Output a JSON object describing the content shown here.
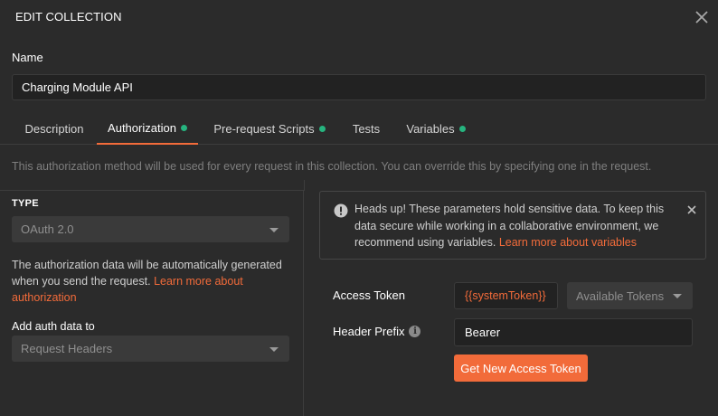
{
  "modal": {
    "title": "EDIT COLLECTION"
  },
  "name_field": {
    "label": "Name",
    "value": "Charging Module API"
  },
  "tabs": [
    {
      "label": "Description",
      "active": false,
      "has_dot": false
    },
    {
      "label": "Authorization",
      "active": true,
      "has_dot": true
    },
    {
      "label": "Pre-request Scripts",
      "active": false,
      "has_dot": true
    },
    {
      "label": "Tests",
      "active": false,
      "has_dot": false
    },
    {
      "label": "Variables",
      "active": false,
      "has_dot": true
    }
  ],
  "info_text": "This authorization method will be used for every request in this collection. You can override this by specifying one in the request.",
  "left": {
    "type_label": "TYPE",
    "type_value": "OAuth 2.0",
    "desc_text": "The authorization data will be automatically generated when you send the request.",
    "desc_link": "Learn more about authorization",
    "add_auth_label": "Add auth data to",
    "add_auth_value": "Request Headers"
  },
  "alert": {
    "text": "Heads up! These parameters hold sensitive data. To keep this data secure while working in a collaborative environment, we recommend using variables.",
    "link": "Learn more about variables"
  },
  "right": {
    "access_token_label": "Access Token",
    "access_token_value": "{{systemToken}}",
    "available_tokens": "Available Tokens",
    "header_prefix_label": "Header Prefix",
    "header_prefix_hint": "i",
    "header_prefix_value": "Bearer",
    "get_token_button": "Get New Access Token"
  },
  "colors": {
    "background": "#2b2b2b",
    "accent": "#f26b3a",
    "status_dot": "#26b47f"
  },
  "icons": {
    "close": "close-icon",
    "alert": "info-circle-icon",
    "alert_close": "close-icon",
    "dropdown": "chevron-down-icon"
  }
}
